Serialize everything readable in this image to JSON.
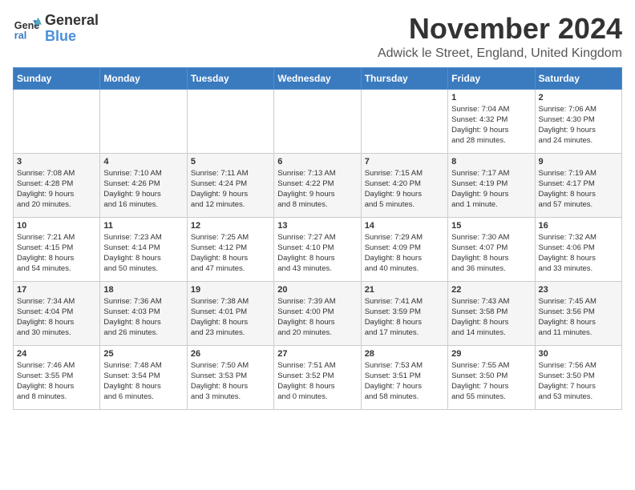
{
  "logo": {
    "line1": "General",
    "line2": "Blue"
  },
  "title": "November 2024",
  "location": "Adwick le Street, England, United Kingdom",
  "weekdays": [
    "Sunday",
    "Monday",
    "Tuesday",
    "Wednesday",
    "Thursday",
    "Friday",
    "Saturday"
  ],
  "weeks": [
    [
      {
        "day": "",
        "info": ""
      },
      {
        "day": "",
        "info": ""
      },
      {
        "day": "",
        "info": ""
      },
      {
        "day": "",
        "info": ""
      },
      {
        "day": "",
        "info": ""
      },
      {
        "day": "1",
        "info": "Sunrise: 7:04 AM\nSunset: 4:32 PM\nDaylight: 9 hours\nand 28 minutes."
      },
      {
        "day": "2",
        "info": "Sunrise: 7:06 AM\nSunset: 4:30 PM\nDaylight: 9 hours\nand 24 minutes."
      }
    ],
    [
      {
        "day": "3",
        "info": "Sunrise: 7:08 AM\nSunset: 4:28 PM\nDaylight: 9 hours\nand 20 minutes."
      },
      {
        "day": "4",
        "info": "Sunrise: 7:10 AM\nSunset: 4:26 PM\nDaylight: 9 hours\nand 16 minutes."
      },
      {
        "day": "5",
        "info": "Sunrise: 7:11 AM\nSunset: 4:24 PM\nDaylight: 9 hours\nand 12 minutes."
      },
      {
        "day": "6",
        "info": "Sunrise: 7:13 AM\nSunset: 4:22 PM\nDaylight: 9 hours\nand 8 minutes."
      },
      {
        "day": "7",
        "info": "Sunrise: 7:15 AM\nSunset: 4:20 PM\nDaylight: 9 hours\nand 5 minutes."
      },
      {
        "day": "8",
        "info": "Sunrise: 7:17 AM\nSunset: 4:19 PM\nDaylight: 9 hours\nand 1 minute."
      },
      {
        "day": "9",
        "info": "Sunrise: 7:19 AM\nSunset: 4:17 PM\nDaylight: 8 hours\nand 57 minutes."
      }
    ],
    [
      {
        "day": "10",
        "info": "Sunrise: 7:21 AM\nSunset: 4:15 PM\nDaylight: 8 hours\nand 54 minutes."
      },
      {
        "day": "11",
        "info": "Sunrise: 7:23 AM\nSunset: 4:14 PM\nDaylight: 8 hours\nand 50 minutes."
      },
      {
        "day": "12",
        "info": "Sunrise: 7:25 AM\nSunset: 4:12 PM\nDaylight: 8 hours\nand 47 minutes."
      },
      {
        "day": "13",
        "info": "Sunrise: 7:27 AM\nSunset: 4:10 PM\nDaylight: 8 hours\nand 43 minutes."
      },
      {
        "day": "14",
        "info": "Sunrise: 7:29 AM\nSunset: 4:09 PM\nDaylight: 8 hours\nand 40 minutes."
      },
      {
        "day": "15",
        "info": "Sunrise: 7:30 AM\nSunset: 4:07 PM\nDaylight: 8 hours\nand 36 minutes."
      },
      {
        "day": "16",
        "info": "Sunrise: 7:32 AM\nSunset: 4:06 PM\nDaylight: 8 hours\nand 33 minutes."
      }
    ],
    [
      {
        "day": "17",
        "info": "Sunrise: 7:34 AM\nSunset: 4:04 PM\nDaylight: 8 hours\nand 30 minutes."
      },
      {
        "day": "18",
        "info": "Sunrise: 7:36 AM\nSunset: 4:03 PM\nDaylight: 8 hours\nand 26 minutes."
      },
      {
        "day": "19",
        "info": "Sunrise: 7:38 AM\nSunset: 4:01 PM\nDaylight: 8 hours\nand 23 minutes."
      },
      {
        "day": "20",
        "info": "Sunrise: 7:39 AM\nSunset: 4:00 PM\nDaylight: 8 hours\nand 20 minutes."
      },
      {
        "day": "21",
        "info": "Sunrise: 7:41 AM\nSunset: 3:59 PM\nDaylight: 8 hours\nand 17 minutes."
      },
      {
        "day": "22",
        "info": "Sunrise: 7:43 AM\nSunset: 3:58 PM\nDaylight: 8 hours\nand 14 minutes."
      },
      {
        "day": "23",
        "info": "Sunrise: 7:45 AM\nSunset: 3:56 PM\nDaylight: 8 hours\nand 11 minutes."
      }
    ],
    [
      {
        "day": "24",
        "info": "Sunrise: 7:46 AM\nSunset: 3:55 PM\nDaylight: 8 hours\nand 8 minutes."
      },
      {
        "day": "25",
        "info": "Sunrise: 7:48 AM\nSunset: 3:54 PM\nDaylight: 8 hours\nand 6 minutes."
      },
      {
        "day": "26",
        "info": "Sunrise: 7:50 AM\nSunset: 3:53 PM\nDaylight: 8 hours\nand 3 minutes."
      },
      {
        "day": "27",
        "info": "Sunrise: 7:51 AM\nSunset: 3:52 PM\nDaylight: 8 hours\nand 0 minutes."
      },
      {
        "day": "28",
        "info": "Sunrise: 7:53 AM\nSunset: 3:51 PM\nDaylight: 7 hours\nand 58 minutes."
      },
      {
        "day": "29",
        "info": "Sunrise: 7:55 AM\nSunset: 3:50 PM\nDaylight: 7 hours\nand 55 minutes."
      },
      {
        "day": "30",
        "info": "Sunrise: 7:56 AM\nSunset: 3:50 PM\nDaylight: 7 hours\nand 53 minutes."
      }
    ]
  ]
}
